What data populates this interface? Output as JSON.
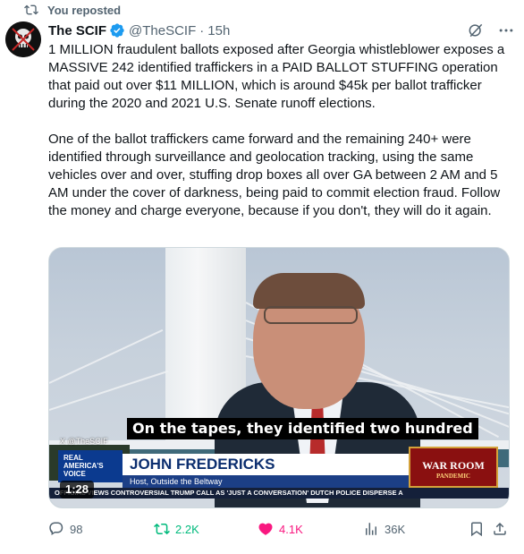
{
  "repost": {
    "label": "You reposted"
  },
  "author": {
    "name": "The SCIF",
    "handle": "@TheSCIF",
    "separator": "·",
    "time": "15h"
  },
  "tweet": {
    "text": "1 MILLION fraudulent ballots exposed after Georgia whistleblower exposes a MASSIVE 242 identified traffickers in a PAID BALLOT STUFFING operation that paid out over $11 MILLION, which is around $45k per ballot trafficker during the 2020 and 2021 U.S. Senate runoff elections.\n\nOne of the ballot traffickers came forward and the remaining 240+ were identified through surveillance and geolocation tracking, using the same vehicles over and over, stuffing drop boxes all over GA between 2 AM and 5 AM under the cover of darkness, being paid to commit election fraud. Follow the money and charge everyone, because if you don't, they will do it again."
  },
  "video": {
    "caption": "On the tapes, they identified two hundred",
    "watermark": "X @TheSCIF",
    "network_logo": "REAL AMERICA'S VOICE",
    "lower_third_name": "JOHN FREDERICKS",
    "lower_third_sub": "Host, Outside the Beltway",
    "warroom": "WAR ROOM",
    "warroom_sub": "PANDEMIC",
    "ticker": "OFFICIAL VIEWS CONTROVERSIAL TRUMP CALL AS 'JUST A CONVERSATION'     DUTCH POLICE DISPERSE A",
    "duration": "1:28"
  },
  "actions": {
    "replies": "98",
    "reposts": "2.2K",
    "likes": "4.1K",
    "views": "36K"
  },
  "colors": {
    "accent": "#1d9bf0",
    "retweet": "#00ba7c",
    "like": "#f91880",
    "muted": "#536471"
  }
}
